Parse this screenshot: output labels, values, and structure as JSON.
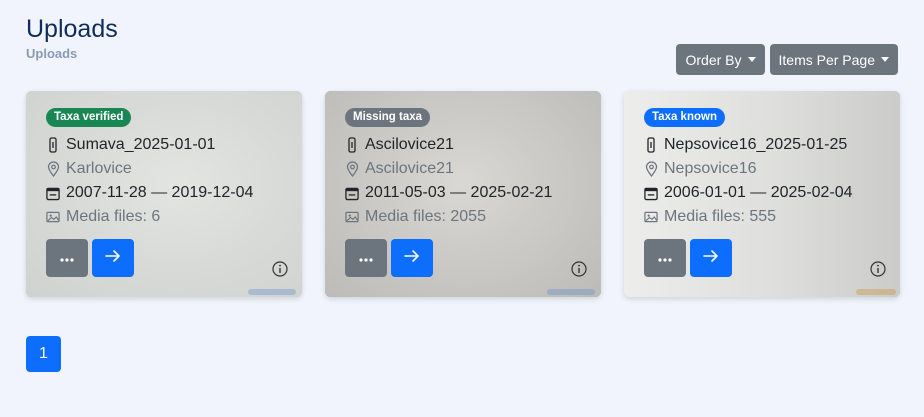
{
  "header": {
    "title": "Uploads",
    "breadcrumb": "Uploads"
  },
  "toolbar": {
    "order_by": "Order By",
    "items_per_page": "Items Per Page"
  },
  "cards": [
    {
      "badge": "Taxa verified",
      "badge_color": "#198754",
      "name": "Sumava_2025-01-01",
      "location": "Karlovice",
      "dates": "2007-11-28 — 2019-12-04",
      "media": "Media files: 6"
    },
    {
      "badge": "Missing taxa",
      "badge_color": "#6c757d",
      "name": "Ascilovice21",
      "location": "Ascilovice21",
      "dates": "2011-05-03 — 2025-02-21",
      "media": "Media files: 2055"
    },
    {
      "badge": "Taxa known",
      "badge_color": "#0d6efd",
      "name": "Nepsovice16_2025-01-25",
      "location": "Nepsovice16",
      "dates": "2006-01-01 — 2025-02-04",
      "media": "Media files: 555"
    }
  ],
  "pagination": {
    "current": "1"
  },
  "icons": {
    "name": "thermometer-icon",
    "location": "map-pin-icon",
    "dates": "calendar-range-icon",
    "media": "images-icon",
    "more": "three-dots-icon",
    "go": "arrow-right-icon",
    "info": "info-circle-icon"
  }
}
